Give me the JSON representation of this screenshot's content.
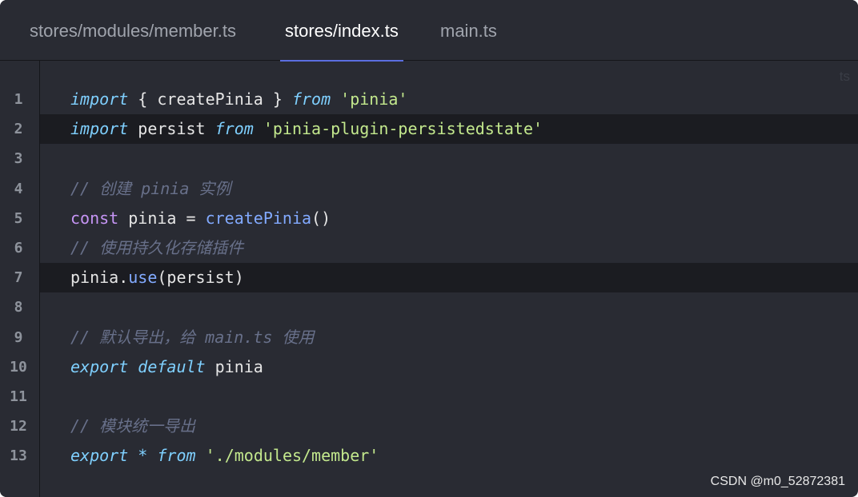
{
  "tabs": [
    {
      "label": "stores/modules/member.ts",
      "active": false
    },
    {
      "label": "stores/index.ts",
      "active": true
    },
    {
      "label": "main.ts",
      "active": false
    }
  ],
  "language_badge": "ts",
  "code": {
    "line_numbers": [
      "1",
      "2",
      "3",
      "4",
      "5",
      "6",
      "7",
      "8",
      "9",
      "10",
      "11",
      "12",
      "13"
    ],
    "lines": [
      [
        {
          "t": "import",
          "c": "kw-it"
        },
        {
          "t": " { createPinia } ",
          "c": "pl"
        },
        {
          "t": "from",
          "c": "kw-it"
        },
        {
          "t": " ",
          "c": "pl"
        },
        {
          "t": "'pinia'",
          "c": "str"
        }
      ],
      [
        {
          "t": "import",
          "c": "kw-it"
        },
        {
          "t": " persist ",
          "c": "pl"
        },
        {
          "t": "from",
          "c": "kw-it"
        },
        {
          "t": " ",
          "c": "pl"
        },
        {
          "t": "'pinia-plugin-persistedstate'",
          "c": "str"
        }
      ],
      [],
      [
        {
          "t": "// 创建 pinia 实例",
          "c": "cm"
        }
      ],
      [
        {
          "t": "const",
          "c": "kw"
        },
        {
          "t": " pinia = ",
          "c": "pl"
        },
        {
          "t": "createPinia",
          "c": "fn"
        },
        {
          "t": "()",
          "c": "pl"
        }
      ],
      [
        {
          "t": "// 使用持久化存储插件",
          "c": "cm"
        }
      ],
      [
        {
          "t": "pinia.",
          "c": "pl"
        },
        {
          "t": "use",
          "c": "fn"
        },
        {
          "t": "(persist)",
          "c": "pl"
        }
      ],
      [],
      [
        {
          "t": "// 默认导出，给 main.ts 使用",
          "c": "cm"
        }
      ],
      [
        {
          "t": "export",
          "c": "kw-it"
        },
        {
          "t": " ",
          "c": "pl"
        },
        {
          "t": "default",
          "c": "kw-it"
        },
        {
          "t": " pinia",
          "c": "pl"
        }
      ],
      [],
      [
        {
          "t": "// 模块统一导出",
          "c": "cm"
        }
      ],
      [
        {
          "t": "export",
          "c": "kw-it"
        },
        {
          "t": " ",
          "c": "pl"
        },
        {
          "t": "*",
          "c": "kw-it"
        },
        {
          "t": " ",
          "c": "pl"
        },
        {
          "t": "from",
          "c": "kw-it"
        },
        {
          "t": " ",
          "c": "pl"
        },
        {
          "t": "'./modules/member'",
          "c": "str"
        }
      ]
    ],
    "highlighted_lines": [
      2,
      7
    ]
  },
  "watermark": "CSDN @m0_52872381"
}
